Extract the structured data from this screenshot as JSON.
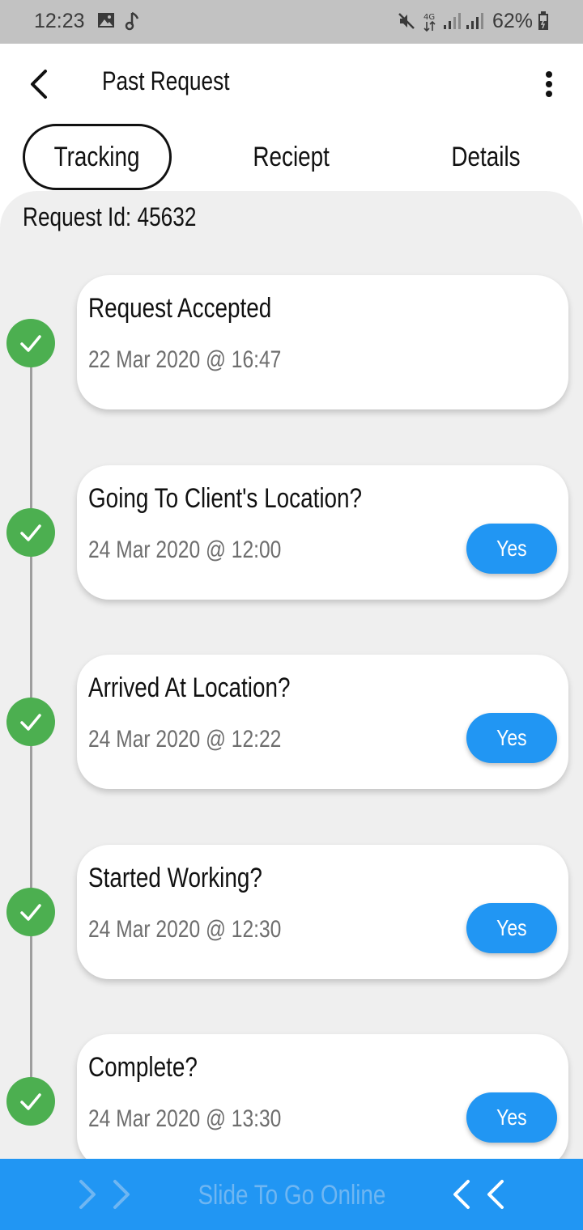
{
  "status_bar": {
    "time": "12:23",
    "battery_percent": "62%",
    "icons": [
      "image-icon",
      "music-note-icon",
      "mute-icon",
      "4g-icon",
      "signal-icon",
      "signal-icon",
      "battery-icon"
    ]
  },
  "header": {
    "title": "Past Request",
    "back_icon": "chevron-left-icon",
    "menu_icon": "more-vertical-icon"
  },
  "tabs": [
    {
      "label": "Tracking",
      "active": true
    },
    {
      "label": "Reciept",
      "active": false
    },
    {
      "label": "Details",
      "active": false
    }
  ],
  "request": {
    "id_label": "Request Id: 45632"
  },
  "timeline": [
    {
      "title": "Request Accepted",
      "timestamp": "22 Mar 2020 @ 16:47",
      "has_button": false
    },
    {
      "title": "Going To Client's Location?",
      "timestamp": "24 Mar 2020 @ 12:00",
      "has_button": true,
      "button_label": "Yes"
    },
    {
      "title": "Arrived At Location?",
      "timestamp": "24 Mar 2020 @ 12:22",
      "has_button": true,
      "button_label": "Yes"
    },
    {
      "title": "Started Working?",
      "timestamp": "24 Mar 2020 @ 12:30",
      "has_button": true,
      "button_label": "Yes"
    },
    {
      "title": "Complete?",
      "timestamp": "24 Mar 2020 @ 13:30",
      "has_button": true,
      "button_label": "Yes"
    }
  ],
  "slider": {
    "label": "Slide To Go Online"
  },
  "colors": {
    "accent": "#2196f3",
    "check": "#4caf50",
    "panel_bg": "#efefef",
    "status_bar": "#c2c2c2"
  }
}
